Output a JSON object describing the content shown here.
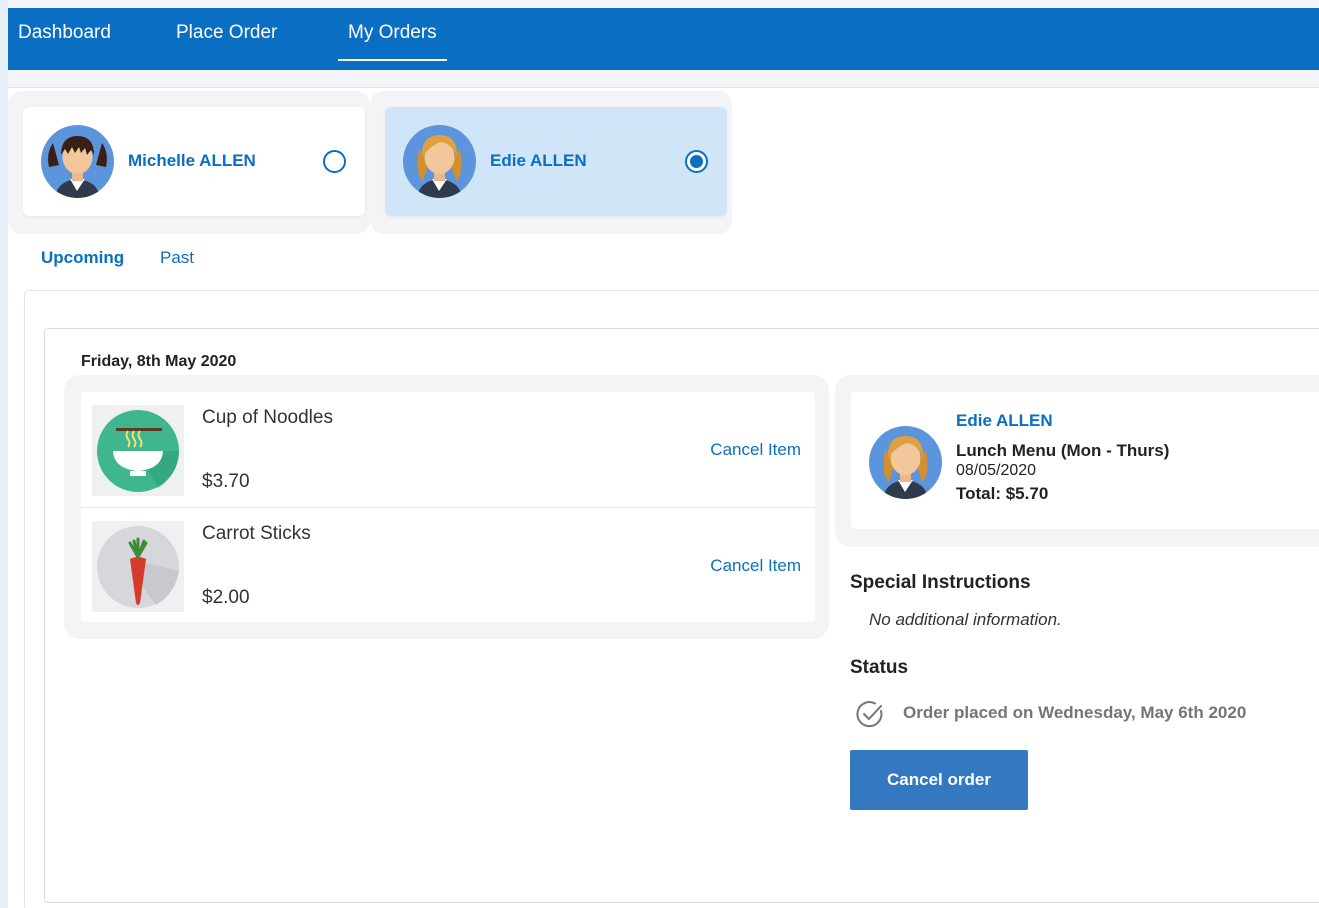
{
  "nav": {
    "tabs": [
      {
        "label": "Dashboard"
      },
      {
        "label": "Place Order"
      },
      {
        "label": "My Orders"
      }
    ],
    "active_tab": "My Orders"
  },
  "children": [
    {
      "name": "Michelle ALLEN",
      "selected": false
    },
    {
      "name": "Edie ALLEN",
      "selected": true
    }
  ],
  "order_tabs": [
    {
      "label": "Upcoming"
    },
    {
      "label": "Past"
    }
  ],
  "active_order_tab": "Upcoming",
  "order": {
    "date": "Friday, 8th May 2020",
    "items": [
      {
        "name": "Cup of Noodles",
        "price": "$3.70",
        "cancel_label": "Cancel Item",
        "icon": "noodles-icon"
      },
      {
        "name": "Carrot Sticks",
        "price": "$2.00",
        "cancel_label": "Cancel Item",
        "icon": "carrot-icon"
      }
    ],
    "summary": {
      "student": "Edie ALLEN",
      "menu": "Lunch Menu (Mon - Thurs)",
      "date": "08/05/2020",
      "total": "Total: $5.70"
    },
    "special_instructions": {
      "heading": "Special Instructions",
      "text": "No additional information."
    },
    "status": {
      "heading": "Status",
      "text": "Order placed on Wednesday, May 6th 2020",
      "icon": "check-circle-icon"
    },
    "cancel_order_label": "Cancel order"
  },
  "colors": {
    "primary": "#0a6fc2",
    "selected_card": "#d0e5f8",
    "button": "#3478c1",
    "avatar_bg": "#5c95dc"
  }
}
